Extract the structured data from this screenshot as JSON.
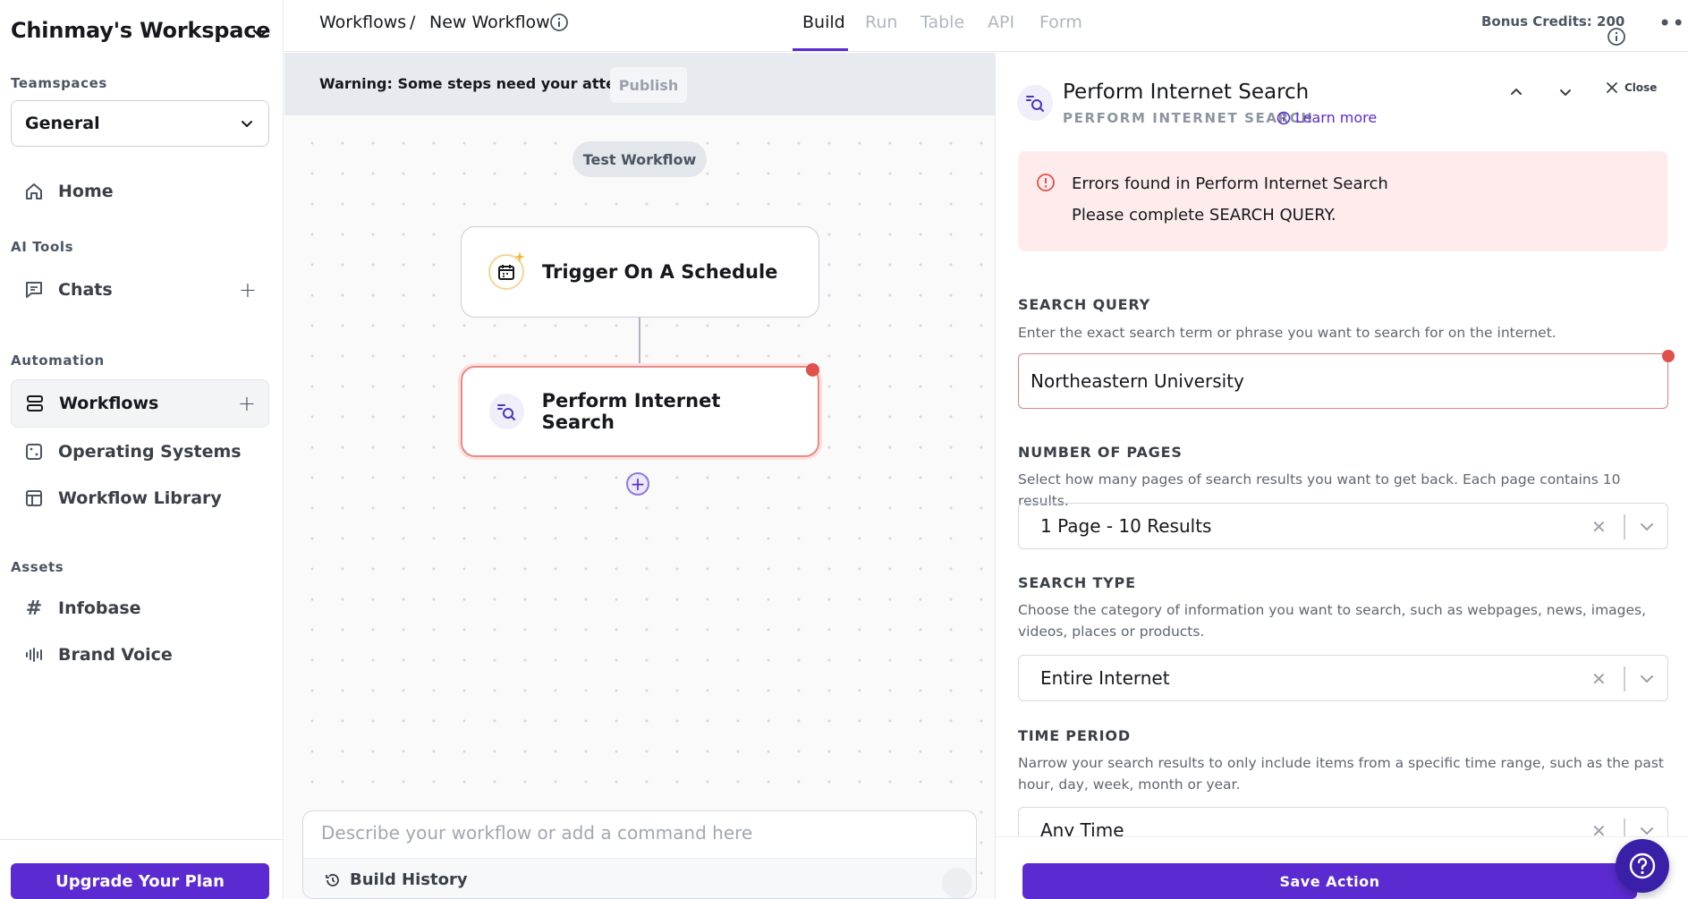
{
  "workspace": {
    "title": "Chinmay's Workspace"
  },
  "sidebar": {
    "teamspaces_label": "Teamspaces",
    "teamspace_selected": "General",
    "home_label": "Home",
    "ai_tools_label": "AI Tools",
    "chats_label": "Chats",
    "automation_label": "Automation",
    "workflows_label": "Workflows",
    "operating_systems_label": "Operating Systems",
    "workflow_library_label": "Workflow Library",
    "assets_label": "Assets",
    "infobase_label": "Infobase",
    "brand_voice_label": "Brand Voice",
    "upgrade_label": "Upgrade Your Plan"
  },
  "topbar": {
    "breadcrumb_root": "Workflows",
    "breadcrumb_sep": "/",
    "breadcrumb_current": "New Workflow",
    "tabs": [
      "Build",
      "Run",
      "Table",
      "API",
      "Form"
    ],
    "active_tab": "Build",
    "credits": "Bonus Credits: 200"
  },
  "canvas": {
    "warning": "Warning: Some steps need your attention",
    "publish_label": "Publish",
    "test_label": "Test Workflow",
    "nodes": [
      {
        "label": "Trigger On A Schedule",
        "icon": "calendar-icon"
      },
      {
        "label": "Perform Internet Search",
        "icon": "search-list-icon",
        "error": true
      }
    ],
    "command_placeholder": "Describe your workflow or add a command here",
    "build_history_label": "Build History"
  },
  "panel": {
    "title": "Perform Internet Search",
    "subtitle": "PERFORM INTERNET SEARCH",
    "learn_more": "Learn more",
    "close_label": "Close",
    "error_title": "Errors found in Perform Internet Search",
    "error_message": "Please complete SEARCH QUERY.",
    "search_query": {
      "label": "SEARCH QUERY",
      "help": "Enter the exact search term or phrase you want to search for on the internet.",
      "value": "Northeastern University"
    },
    "num_pages": {
      "label": "NUMBER OF PAGES",
      "help": "Select how many pages of search results you want to get back. Each page contains 10 results.",
      "value": "1 Page - 10 Results"
    },
    "search_type": {
      "label": "SEARCH TYPE",
      "help": "Choose the category of information you want to search, such as webpages, news, images, videos, places or products.",
      "value": "Entire Internet"
    },
    "time_period": {
      "label": "TIME PERIOD",
      "help": "Narrow your search results to only include items from a specific time range, such as the past hour, day, week, month or year.",
      "value": "Any Time"
    },
    "save_label": "Save Action"
  },
  "colors": {
    "accent": "#5b2bd1",
    "error": "#e0514b",
    "error_bg": "#fdeceb"
  }
}
